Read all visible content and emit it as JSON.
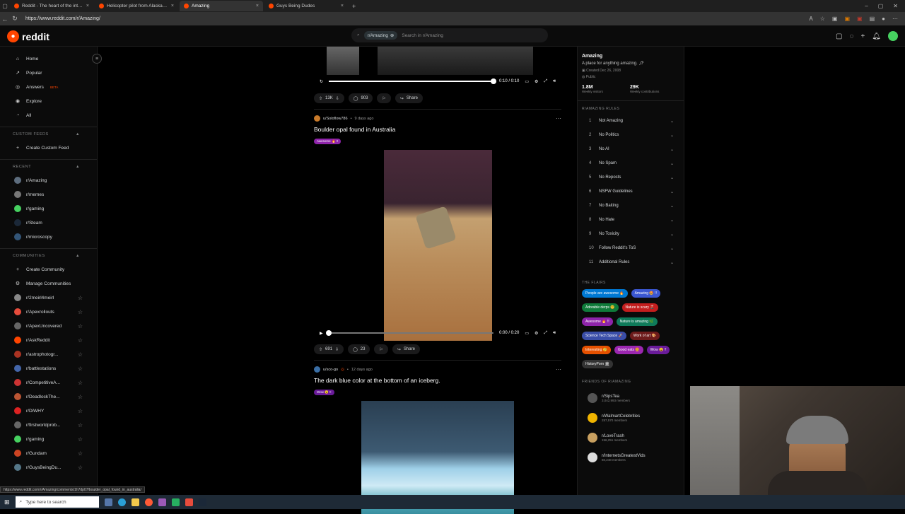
{
  "browser": {
    "tabs": [
      {
        "title": "Reddit - The heart of the internet",
        "color": "#ff4500",
        "active": false
      },
      {
        "title": "Helicopter pilot from Alaska sho",
        "color": "#ff4500",
        "active": false
      },
      {
        "title": "Amazing",
        "color": "#ff4500",
        "active": true
      },
      {
        "title": "Guys Being Dudes",
        "color": "#ff4500",
        "active": false
      }
    ],
    "url": "https://www.reddit.com/r/Amazing/"
  },
  "header": {
    "logo": "reddit",
    "search_chip": "r/Amazing",
    "search_placeholder": "Search in r/Amazing"
  },
  "sidebar": {
    "nav": [
      {
        "label": "Home",
        "icon": "home-icon"
      },
      {
        "label": "Popular",
        "icon": "popular-icon"
      },
      {
        "label": "Answers",
        "icon": "answers-icon",
        "badge": "BETA"
      },
      {
        "label": "Explore",
        "icon": "explore-icon"
      },
      {
        "label": "All",
        "icon": "all-icon"
      }
    ],
    "custom_feeds_heading": "CUSTOM FEEDS",
    "create_custom_feed": "Create Custom Feed",
    "recent_heading": "RECENT",
    "recent": [
      {
        "label": "r/Amazing",
        "color": "#5d6d7e"
      },
      {
        "label": "r/memes",
        "color": "#777777"
      },
      {
        "label": "r/gaming",
        "color": "#46d160"
      },
      {
        "label": "r/Steam",
        "color": "#1b2838"
      },
      {
        "label": "r/microscopy",
        "color": "#335577"
      }
    ],
    "communities_heading": "COMMUNITIES",
    "create_community": "Create Community",
    "manage_communities": "Manage Communities",
    "communities": [
      {
        "label": "r/2meirl4meirl",
        "color": "#888888"
      },
      {
        "label": "r/Apexrollouts",
        "color": "#e74c3c"
      },
      {
        "label": "r/ApexUncovered",
        "color": "#666666"
      },
      {
        "label": "r/AskReddit",
        "color": "#ff4500"
      },
      {
        "label": "r/astrophotogr...",
        "color": "#aa3322"
      },
      {
        "label": "r/battlestations",
        "color": "#4466aa"
      },
      {
        "label": "r/CompetitiveA...",
        "color": "#cc3333"
      },
      {
        "label": "r/DeadlockThe...",
        "color": "#bb5533"
      },
      {
        "label": "r/DiWHY",
        "color": "#dd2222"
      },
      {
        "label": "r/firstworldprob...",
        "color": "#666666"
      },
      {
        "label": "r/gaming",
        "color": "#46d160"
      },
      {
        "label": "r/Gundam",
        "color": "#cc4422"
      },
      {
        "label": "r/GuysBeingDu...",
        "color": "#557788"
      }
    ]
  },
  "feed": {
    "post0": {
      "time": "0:10 / 0:10",
      "votes": "13K",
      "comments": "903",
      "share": "Share",
      "progress": 1.0
    },
    "post1": {
      "user": "u/Soloflow786",
      "age": "9 days ago",
      "title": "Boulder opal found in Australia",
      "flair": "Awesome",
      "time": "0:00 / 0:20",
      "votes": "691",
      "comments": "23",
      "share": "Share",
      "progress": 0.0
    },
    "post2": {
      "user": "u/sco-go",
      "age": "12 days ago",
      "title": "The dark blue color at the bottom of an iceberg.",
      "flair": "Wow"
    }
  },
  "right": {
    "name": "Amazing",
    "desc": "A place for anything amazing.",
    "created": "Created Dec 26, 2008",
    "visibility": "Public",
    "visitors": "1.8M",
    "visitors_label": "Weekly visitors",
    "contrib": "29K",
    "contrib_label": "Weekly contributions",
    "rules_heading": "R/AMAZING RULES",
    "rules": [
      {
        "n": "1",
        "t": "Not Amazing"
      },
      {
        "n": "2",
        "t": "No Politics"
      },
      {
        "n": "3",
        "t": "No AI"
      },
      {
        "n": "4",
        "t": "No Spam"
      },
      {
        "n": "5",
        "t": "No Reposts"
      },
      {
        "n": "6",
        "t": "NSFW Guidelines"
      },
      {
        "n": "7",
        "t": "No Baiting"
      },
      {
        "n": "8",
        "t": "No Hate"
      },
      {
        "n": "9",
        "t": "No Toxicity"
      },
      {
        "n": "10",
        "t": "Follow Reddit's ToS"
      },
      {
        "n": "11",
        "t": "Additional Rules"
      }
    ],
    "flairs_heading": "THE FLAIRS",
    "flairs": [
      {
        "t": "People are awesome 🔥",
        "c": "#0079d3"
      },
      {
        "t": "Amazing 🤩 !!",
        "c": "#3b57d1"
      },
      {
        "t": "Adorable derps 😊",
        "c": "#0f7b3a"
      },
      {
        "t": "Nature is scary 🌋",
        "c": "#c41e1e"
      },
      {
        "t": "Awesome 🔥 !!",
        "c": "#8e24aa"
      },
      {
        "t": "Nature is amazing 🌿",
        "c": "#0f7b5a"
      },
      {
        "t": "Science Tech Space 🚀",
        "c": "#3a4ea8"
      },
      {
        "t": "Work of art 🎨",
        "c": "#6d1b1b"
      },
      {
        "t": "Interesting 🧐",
        "c": "#e65100"
      },
      {
        "t": "Good eats 🍔",
        "c": "#9c27b0"
      },
      {
        "t": "Wow 😮 !!",
        "c": "#6a1b9a"
      },
      {
        "t": "HistoryPorn 🏛",
        "c": "#333333"
      }
    ],
    "friends_heading": "FRIENDS OF R/AMAZING",
    "friends": [
      {
        "name": "r/SipsTea",
        "members": "3,042,993 members",
        "color": "#555555"
      },
      {
        "name": "r/WalmartCelebrities",
        "members": "287,570 members",
        "color": "#f0b400"
      },
      {
        "name": "r/LoveTrash",
        "members": "156,251 members",
        "color": "#c8a060"
      },
      {
        "name": "r/InternetsGreatestVids",
        "members": "60,248 members",
        "color": "#dddddd"
      }
    ]
  },
  "status_url": "https://www.reddit.com/r/Amazing/comments/1h7dp07/boulder_opal_found_in_australia/",
  "taskbar": {
    "search": "Type here to search"
  }
}
